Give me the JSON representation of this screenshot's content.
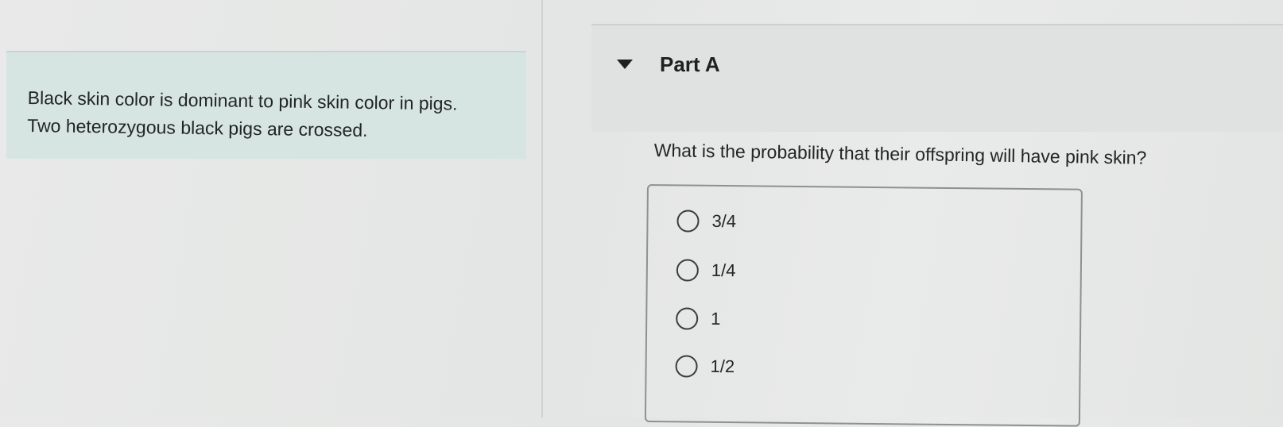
{
  "problem": {
    "intro_text": "Black skin color is dominant to pink skin color in pigs. Two heterozygous black pigs are crossed."
  },
  "part": {
    "title": "Part A",
    "toggle_icon": "caret-down-icon",
    "question": "What is the probability that their offspring will have pink skin?",
    "options": [
      {
        "label": "3/4"
      },
      {
        "label": "1/4"
      },
      {
        "label": "1"
      },
      {
        "label": "1/2"
      }
    ]
  },
  "colors": {
    "intro_panel_bg": "#d7e5e2",
    "page_bg": "#e6e8e7",
    "text": "#222526"
  }
}
